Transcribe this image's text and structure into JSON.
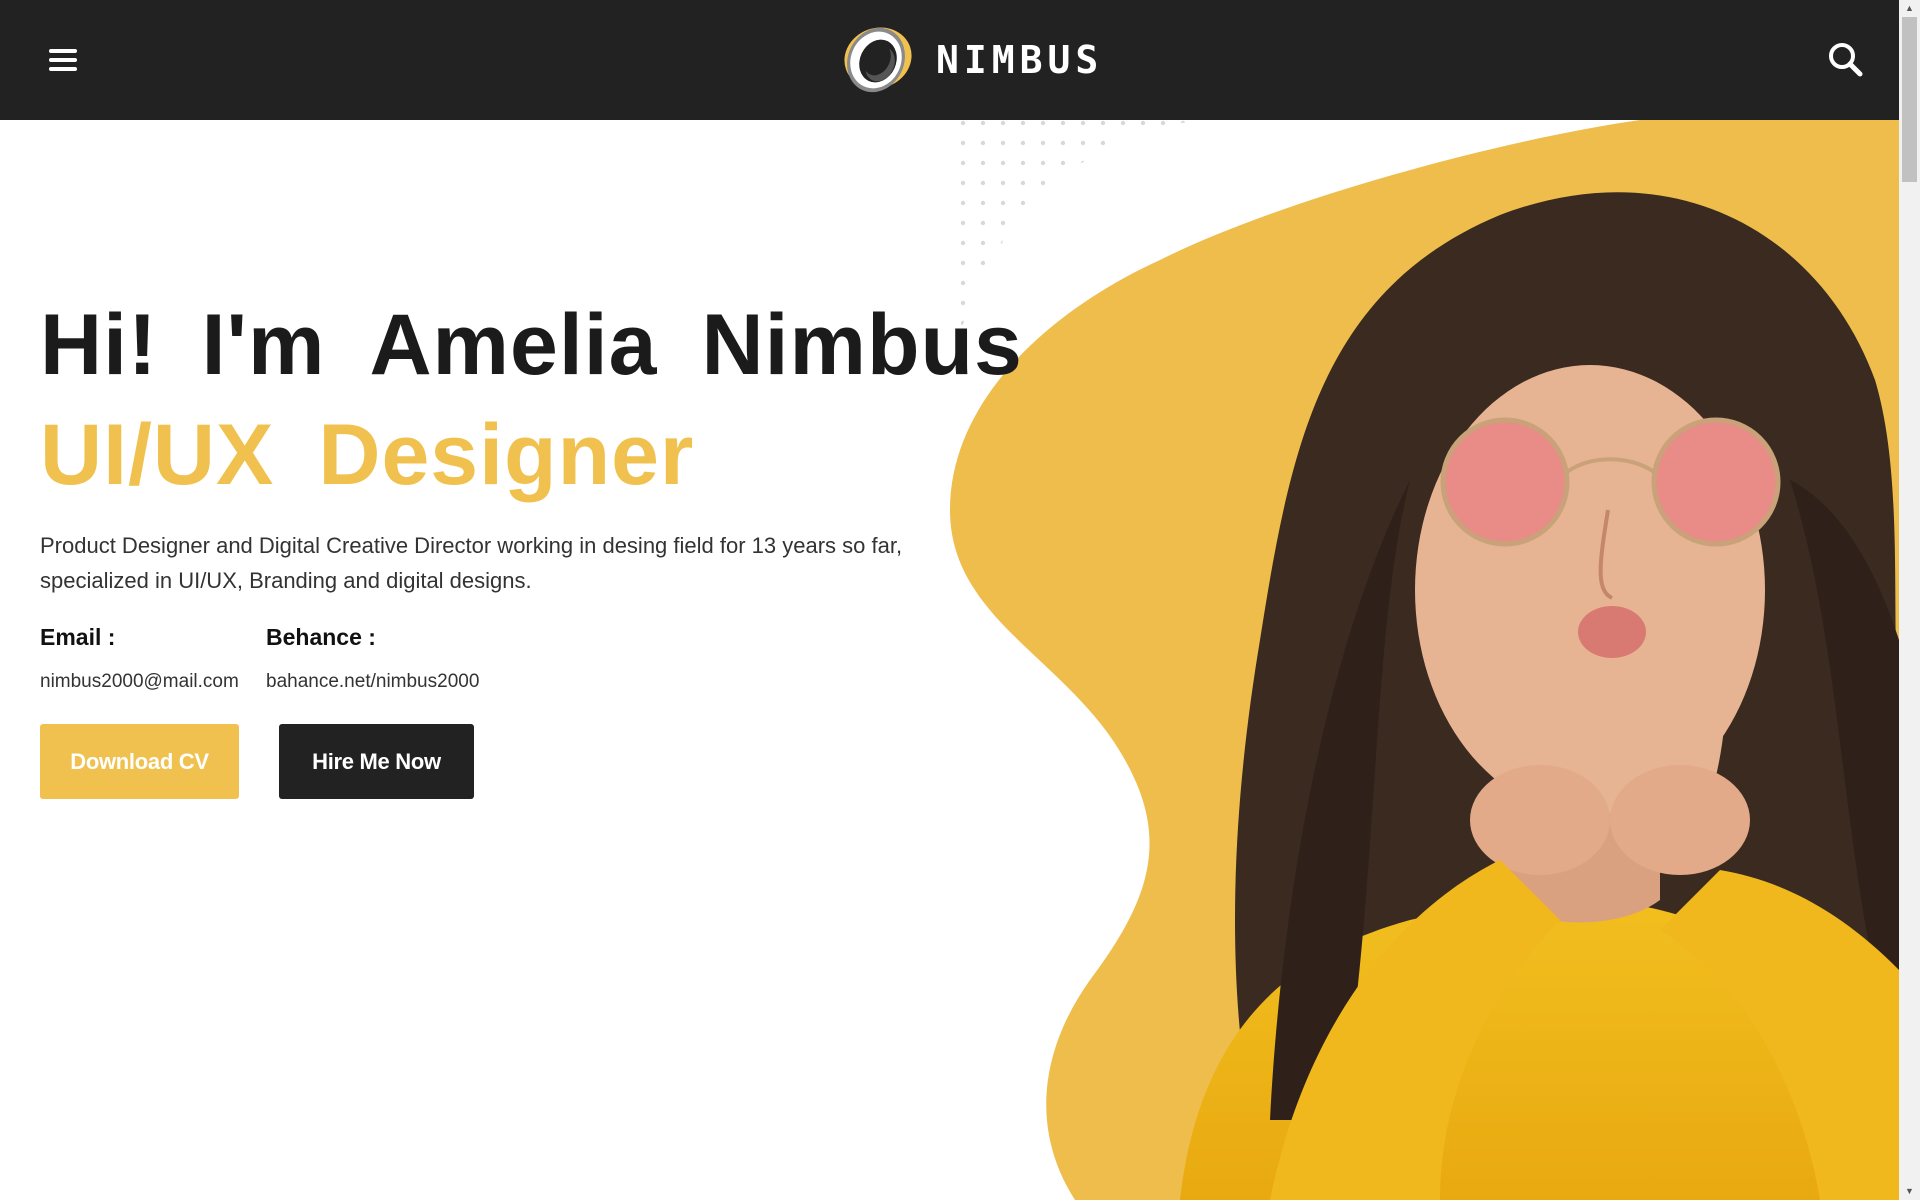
{
  "header": {
    "brand": "NIMBUS",
    "menu_icon": "hamburger-menu-icon",
    "search_icon": "search-icon"
  },
  "hero": {
    "heading_words": [
      "Hi!",
      "I'm",
      "Amelia",
      "Nimbus"
    ],
    "role_words": [
      "UI/UX",
      "Designer"
    ],
    "description": "Product Designer and Digital Creative Director working in desing field for 13 years so far, specialized in UI/UX, Branding and digital designs.",
    "email_label": "Email :",
    "email_value": "nimbus2000@mail.com",
    "behance_label": "Behance :",
    "behance_value": "bahance.net/nimbus2000",
    "download_label": "Download CV",
    "hire_label": "Hire Me Now"
  },
  "colors": {
    "accent": "#f0c14f",
    "dark": "#222222",
    "text": "#1b1b1b"
  }
}
